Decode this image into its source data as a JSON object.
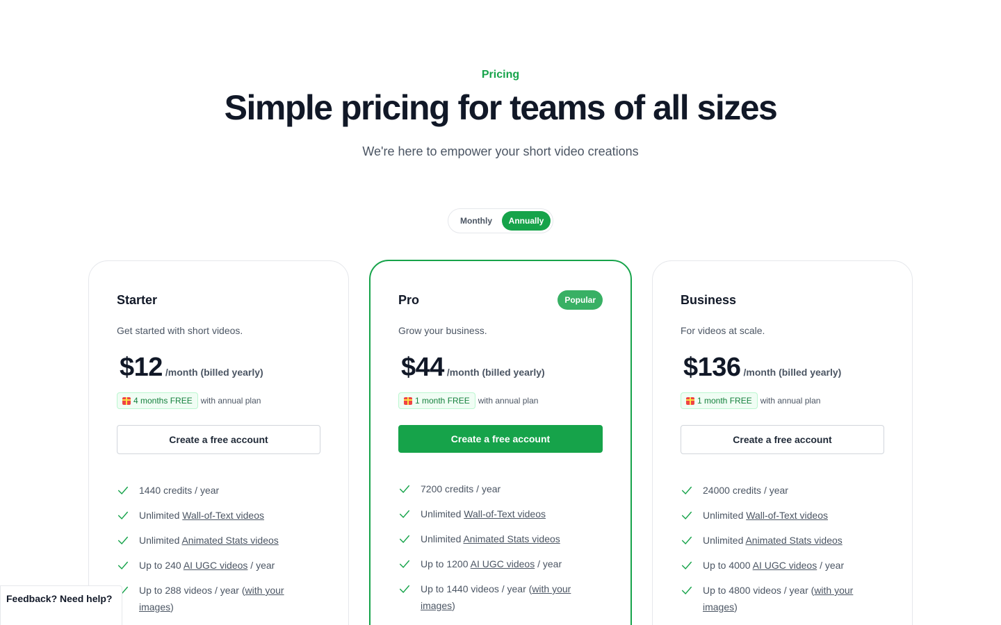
{
  "header": {
    "eyebrow": "Pricing",
    "title": "Simple pricing for teams of all sizes",
    "subtitle": "We're here to empower your short video creations"
  },
  "billing_toggle": {
    "monthly_label": "Monthly",
    "annually_label": "Annually",
    "selected": "Annually"
  },
  "colors": {
    "accent": "#16a34a",
    "text": "#111827",
    "muted": "#4b5563"
  },
  "plans": [
    {
      "name": "Starter",
      "description": "Get started with short videos.",
      "price": "$12",
      "price_suffix": "/month (billed yearly)",
      "promo": "4 months FREE",
      "promo_suffix": "with annual plan",
      "cta": "Create a free account",
      "features": [
        {
          "pre": "1440 credits / year",
          "link": "",
          "post": ""
        },
        {
          "pre": "Unlimited ",
          "link": "Wall-of-Text videos",
          "post": ""
        },
        {
          "pre": "Unlimited ",
          "link": "Animated Stats videos",
          "post": ""
        },
        {
          "pre": "Up to 240 ",
          "link": "AI UGC videos",
          "post": " / year"
        },
        {
          "pre": "Up to 288 videos / year (",
          "link": "with your images",
          "post": ")"
        }
      ]
    },
    {
      "name": "Pro",
      "badge": "Popular",
      "description": "Grow your business.",
      "price": "$44",
      "price_suffix": "/month (billed yearly)",
      "promo": "1 month FREE",
      "promo_suffix": "with annual plan",
      "cta": "Create a free account",
      "features": [
        {
          "pre": "7200 credits / year",
          "link": "",
          "post": ""
        },
        {
          "pre": "Unlimited ",
          "link": "Wall-of-Text videos",
          "post": ""
        },
        {
          "pre": "Unlimited ",
          "link": "Animated Stats videos",
          "post": ""
        },
        {
          "pre": "Up to 1200 ",
          "link": "AI UGC videos",
          "post": " / year"
        },
        {
          "pre": "Up to 1440 videos / year (",
          "link": "with your images",
          "post": ")"
        }
      ]
    },
    {
      "name": "Business",
      "description": "For videos at scale.",
      "price": "$136",
      "price_suffix": "/month (billed yearly)",
      "promo": "1 month FREE",
      "promo_suffix": "with annual plan",
      "cta": "Create a free account",
      "features": [
        {
          "pre": "24000 credits / year",
          "link": "",
          "post": ""
        },
        {
          "pre": "Unlimited ",
          "link": "Wall-of-Text videos",
          "post": ""
        },
        {
          "pre": "Unlimited ",
          "link": "Animated Stats videos",
          "post": ""
        },
        {
          "pre": "Up to 4000 ",
          "link": "AI UGC videos",
          "post": " / year"
        },
        {
          "pre": "Up to 4800 videos / year (",
          "link": "with your images",
          "post": ")"
        }
      ]
    }
  ],
  "feedback_widget": {
    "label": "Feedback? Need help?"
  }
}
